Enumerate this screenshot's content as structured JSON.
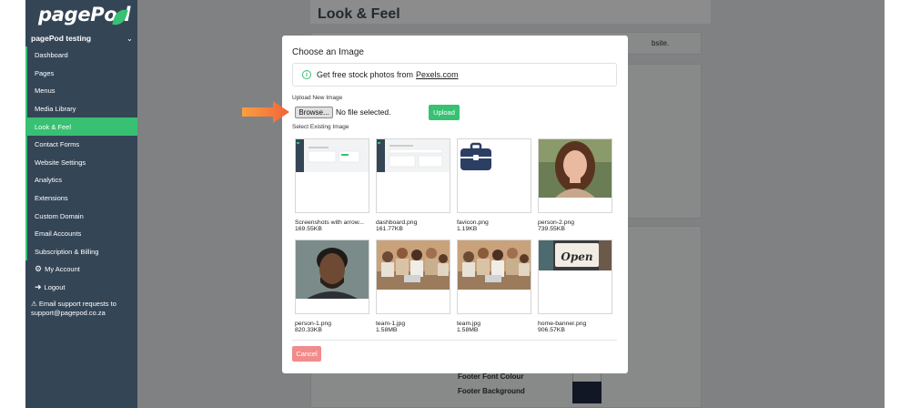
{
  "app": {
    "logo": "pagePod",
    "site_name": "pagePod testing"
  },
  "sidebar": {
    "items": [
      {
        "label": "Dashboard"
      },
      {
        "label": "Pages"
      },
      {
        "label": "Menus"
      },
      {
        "label": "Media Library"
      },
      {
        "label": "Look & Feel",
        "active": true
      },
      {
        "label": "Contact Forms"
      },
      {
        "label": "Website Settings"
      },
      {
        "label": "Analytics"
      },
      {
        "label": "Extensions"
      },
      {
        "label": "Custom Domain"
      },
      {
        "label": "Email Accounts"
      },
      {
        "label": "Subscription & Billing"
      },
      {
        "label": "My Account",
        "icon": "gear-icon"
      },
      {
        "label": "Logout",
        "icon": "logout-icon"
      }
    ],
    "support_line1": "Email support requests to",
    "support_line2": "support@pagepod.co.za"
  },
  "background": {
    "title": "Look & Feel",
    "site_fragment": "bsite.",
    "footer_font_colour": "Footer Font Colour",
    "footer_background": "Footer Background"
  },
  "modal": {
    "title": "Choose an Image",
    "pexels_text": "Get free stock photos from",
    "pexels_link": "Pexels.com",
    "upload_label": "Upload New Image",
    "browse_label": "Browse...",
    "file_status": "No file selected.",
    "upload_button": "Upload",
    "existing_label": "Select Existing Image",
    "cancel_button": "Cancel",
    "images": [
      {
        "name": "Screenshots with arrow...",
        "size": "169.55KB",
        "kind": "screenshot"
      },
      {
        "name": "dashboard.png",
        "size": "161.77KB",
        "kind": "screenshot"
      },
      {
        "name": "favicon.png",
        "size": "1.19KB",
        "kind": "briefcase"
      },
      {
        "name": "person-2.png",
        "size": "739.55KB",
        "kind": "portrait-woman"
      },
      {
        "name": "person-1.png",
        "size": "820.33KB",
        "kind": "portrait-man"
      },
      {
        "name": "team-1.jpg",
        "size": "1.58MB",
        "kind": "team"
      },
      {
        "name": "team.jpg",
        "size": "1.58MB",
        "kind": "team"
      },
      {
        "name": "home-banner.png",
        "size": "906.57KB",
        "kind": "open-sign"
      }
    ],
    "open_sign_text": "Open"
  },
  "colors": {
    "sidebar": "#344556",
    "accent": "#38c172",
    "cancel": "#f28b8b",
    "arrow": "#f4623a"
  }
}
